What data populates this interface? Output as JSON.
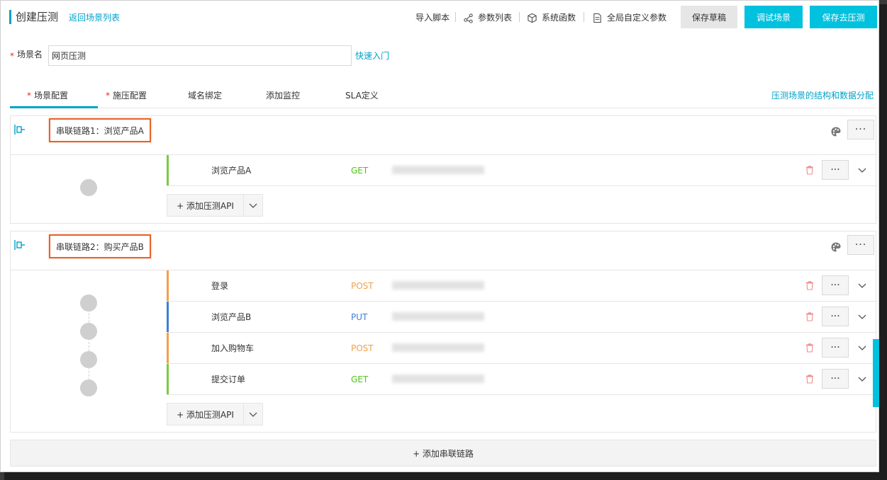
{
  "header": {
    "title": "创建压测",
    "back_link": "返回场景列表",
    "tools": [
      {
        "label": "导入脚本",
        "icon": "none"
      },
      {
        "label": "参数列表",
        "icon": "share-nodes-icon"
      },
      {
        "label": "系统函数",
        "icon": "cube-icon"
      },
      {
        "label": "全局自定义参数",
        "icon": "document-edit-icon"
      }
    ],
    "save_draft": "保存草稿",
    "debug_scene": "调试场景",
    "save_and_test": "保存去压测"
  },
  "scene": {
    "required_mark": "*",
    "label": "场景名",
    "value": "网页压测",
    "quick_start": "快速入门"
  },
  "tabs": {
    "items": [
      {
        "label": "场景配置",
        "required": true,
        "active": true
      },
      {
        "label": "施压配置",
        "required": true,
        "active": false
      },
      {
        "label": "域名绑定",
        "required": false,
        "active": false
      },
      {
        "label": "添加监控",
        "required": false,
        "active": false
      },
      {
        "label": "SLA定义",
        "required": false,
        "active": false
      }
    ],
    "required_mark": "*",
    "right_link": "压测场景的结构和数据分配"
  },
  "chains": [
    {
      "title": "串联链路1：浏览产品A",
      "apis": [
        {
          "name": "浏览产品A",
          "method": "GET",
          "method_color": "#52c41a",
          "accent": "#7ac943"
        }
      ],
      "add_api_label": "+ 添加压测API"
    },
    {
      "title": "串联链路2：购买产品B",
      "apis": [
        {
          "name": "登录",
          "method": "POST",
          "method_color": "#f0a04b",
          "accent": "#f0a04b"
        },
        {
          "name": "浏览产品B",
          "method": "PUT",
          "method_color": "#3d7fd6",
          "accent": "#3d7fd6"
        },
        {
          "name": "加入购物车",
          "method": "POST",
          "method_color": "#f0a04b",
          "accent": "#f0a04b"
        },
        {
          "name": "提交订单",
          "method": "GET",
          "method_color": "#52c41a",
          "accent": "#7ac943"
        }
      ],
      "add_api_label": "+ 添加压测API"
    }
  ],
  "more_label": "···",
  "add_chain_label": "+ 添加串联链路",
  "colors": {
    "accent": "#00a2ca",
    "primary_button": "#00c1de",
    "highlight_border": "#e8632a",
    "required": "#e0301e"
  }
}
